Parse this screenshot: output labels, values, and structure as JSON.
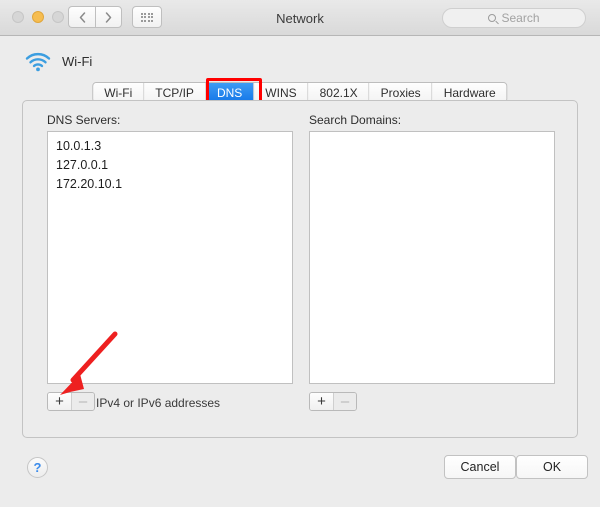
{
  "window": {
    "title": "Network",
    "traffic_lights": [
      "close",
      "minimize",
      "zoom"
    ],
    "nav_back": "‹",
    "nav_forward": "›",
    "grid_button": "show-all"
  },
  "search": {
    "placeholder": "Search",
    "value": ""
  },
  "service": {
    "name": "Wi-Fi",
    "icon": "wifi-icon"
  },
  "tabs": [
    {
      "label": "Wi-Fi",
      "active": false
    },
    {
      "label": "TCP/IP",
      "active": false
    },
    {
      "label": "DNS",
      "active": true
    },
    {
      "label": "WINS",
      "active": false
    },
    {
      "label": "802.1X",
      "active": false
    },
    {
      "label": "Proxies",
      "active": false
    },
    {
      "label": "Hardware",
      "active": false
    }
  ],
  "dns_servers": {
    "label": "DNS Servers:",
    "items": [
      "10.0.1.3",
      "127.0.0.1",
      "172.20.10.1"
    ],
    "add_label": "+",
    "remove_label": "–",
    "hint": "IPv4 or IPv6 addresses"
  },
  "search_domains": {
    "label": "Search Domains:",
    "items": [],
    "add_label": "+",
    "remove_label": "–"
  },
  "footer": {
    "help_label": "?",
    "cancel_label": "Cancel",
    "ok_label": "OK"
  },
  "annotations": {
    "tab_highlight_color": "#ff0000",
    "arrow_color": "#ee2020",
    "arrow_target": "dns-add-button"
  },
  "colors": {
    "accent_blue": "#1477e8",
    "window_bg": "#ececec",
    "list_bg": "#ffffff",
    "minimize_amber": "#f6bd50"
  }
}
